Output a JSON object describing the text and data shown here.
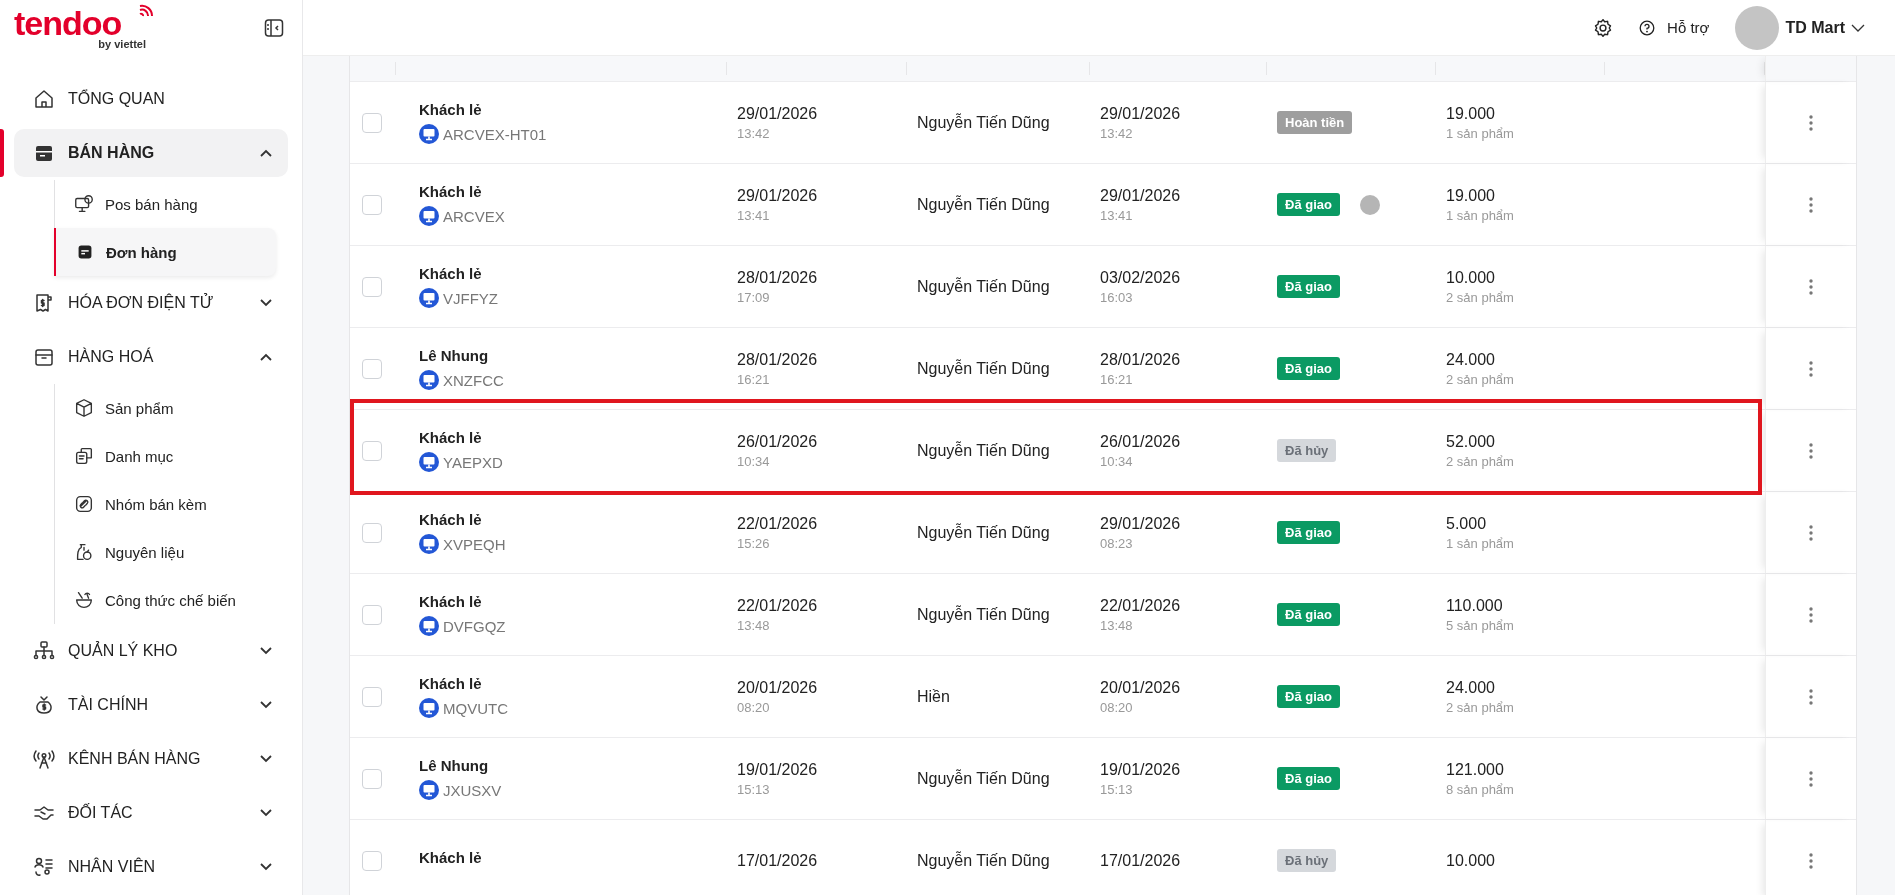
{
  "logo": {
    "brand": "tendoo",
    "tagline": "by viettel"
  },
  "sidebar": {
    "items": [
      {
        "label": "TỔNG QUAN",
        "selected": false
      },
      {
        "label": "BÁN HÀNG",
        "selected": true,
        "expanded": true,
        "children": [
          {
            "label": "Pos bán hàng",
            "selected": false
          },
          {
            "label": "Đơn hàng",
            "selected": true
          }
        ]
      },
      {
        "label": "HÓA ĐƠN ĐIỆN TỬ",
        "selected": false,
        "expanded": false
      },
      {
        "label": "HÀNG HOÁ",
        "selected": false,
        "expanded": true,
        "children": [
          {
            "label": "Sản phẩm",
            "selected": false
          },
          {
            "label": "Danh mục",
            "selected": false
          },
          {
            "label": "Nhóm bán kèm",
            "selected": false
          },
          {
            "label": "Nguyên liệu",
            "selected": false
          },
          {
            "label": "Công thức chế biến",
            "selected": false
          }
        ]
      },
      {
        "label": "QUẢN LÝ KHO",
        "selected": false,
        "expanded": false
      },
      {
        "label": "TÀI CHÍNH",
        "selected": false,
        "expanded": false
      },
      {
        "label": "KÊNH BÁN HÀNG",
        "selected": false,
        "expanded": false
      },
      {
        "label": "ĐỐI TÁC",
        "selected": false,
        "expanded": false
      },
      {
        "label": "NHÂN VIÊN",
        "selected": false,
        "expanded": false
      }
    ]
  },
  "topbar": {
    "help": "Hỗ trợ",
    "user": "TD Mart"
  },
  "table": {
    "rows": [
      {
        "customer": "Khách lẻ",
        "code": "ARCVEX-HT01",
        "created_date": "29/01/2026",
        "created_time": "13:42",
        "creator": "Nguyễn Tiến Dũng",
        "done_date": "29/01/2026",
        "done_time": "13:42",
        "status": "Hoàn tiền",
        "color": "#9e9e9e",
        "total": "19.000",
        "items": "1 sản phẩm",
        "checked": false
      },
      {
        "customer": "Khách lẻ",
        "code": "ARCVEX",
        "created_date": "29/01/2026",
        "created_time": "13:41",
        "creator": "Nguyễn Tiến Dũng",
        "done_date": "29/01/2026",
        "done_time": "13:41",
        "status": "Đã giao",
        "color": "#0b9a63",
        "indicator": true,
        "total": "19.000",
        "items": "1 sản phẩm",
        "checked": false
      },
      {
        "customer": "Khách lẻ",
        "code": "VJFFYZ",
        "created_date": "28/01/2026",
        "created_time": "17:09",
        "creator": "Nguyễn Tiến Dũng",
        "done_date": "03/02/2026",
        "done_time": "16:03",
        "status": "Đã giao",
        "color": "#0b9a63",
        "total": "10.000",
        "items": "2 sản phẩm",
        "checked": false
      },
      {
        "customer": "Lê Nhung",
        "code": "XNZFCC",
        "created_date": "28/01/2026",
        "created_time": "16:21",
        "creator": "Nguyễn Tiến Dũng",
        "done_date": "28/01/2026",
        "done_time": "16:21",
        "status": "Đã giao",
        "color": "#0b9a63",
        "total": "24.000",
        "items": "2 sản phẩm",
        "checked": false
      },
      {
        "customer": "Khách lẻ",
        "code": "YAEPXD",
        "created_date": "26/01/2026",
        "created_time": "10:34",
        "creator": "Nguyễn Tiến Dũng",
        "done_date": "26/01/2026",
        "done_time": "10:34",
        "status": "Đã hủy",
        "color": "#d5d8dc",
        "total": "52.000",
        "items": "2 sản phẩm",
        "checked": false,
        "highlighted": true
      },
      {
        "customer": "Khách lẻ",
        "code": "XVPEQH",
        "created_date": "22/01/2026",
        "created_time": "15:26",
        "creator": "Nguyễn Tiến Dũng",
        "done_date": "29/01/2026",
        "done_time": "08:23",
        "status": "Đã giao",
        "color": "#0b9a63",
        "total": "5.000",
        "items": "1 sản phẩm",
        "checked": false
      },
      {
        "customer": "Khách lẻ",
        "code": "DVFGQZ",
        "created_date": "22/01/2026",
        "created_time": "13:48",
        "creator": "Nguyễn Tiến Dũng",
        "done_date": "22/01/2026",
        "done_time": "13:48",
        "status": "Đã giao",
        "color": "#0b9a63",
        "total": "110.000",
        "items": "5 sản phẩm",
        "checked": false
      },
      {
        "customer": "Khách lẻ",
        "code": "MQVUTC",
        "created_date": "20/01/2026",
        "created_time": "08:20",
        "creator": "Hiền",
        "done_date": "20/01/2026",
        "done_time": "08:20",
        "status": "Đã giao",
        "color": "#0b9a63",
        "total": "24.000",
        "items": "2 sản phẩm",
        "checked": false
      },
      {
        "customer": "Lê Nhung",
        "code": "JXUSXV",
        "created_date": "19/01/2026",
        "created_time": "15:13",
        "creator": "Nguyễn Tiến Dũng",
        "done_date": "19/01/2026",
        "done_time": "15:13",
        "status": "Đã giao",
        "color": "#0b9a63",
        "total": "121.000",
        "items": "8 sản phẩm",
        "checked": false
      },
      {
        "customer": "Khách lẻ",
        "created_date": "17/01/2026",
        "creator": "Nguyễn Tiến Dũng",
        "done_date": "17/01/2026",
        "status": "Đã hủy",
        "color": "#d5d8dc",
        "total": "10.000",
        "checked": false
      }
    ]
  }
}
